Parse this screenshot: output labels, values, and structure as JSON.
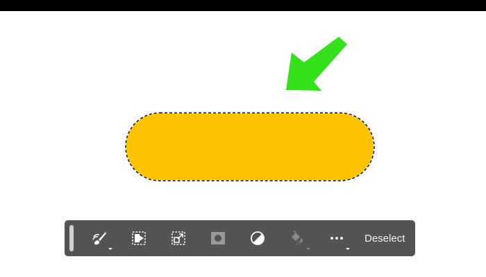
{
  "toolbar": {
    "tools": [
      {
        "icon": "brush-icon",
        "has_menu": true
      },
      {
        "icon": "select-subject-icon",
        "has_menu": false
      },
      {
        "icon": "transform-selection-icon",
        "has_menu": false
      },
      {
        "icon": "mask-icon",
        "has_menu": false
      },
      {
        "icon": "adjustment-layer-icon",
        "has_menu": false
      },
      {
        "icon": "fill-bucket-icon",
        "has_menu": true,
        "disabled": true
      },
      {
        "icon": "more-options-icon",
        "has_menu": true
      }
    ],
    "deselect_label": "Deselect"
  },
  "colors": {
    "shape_fill": "#FDC300",
    "arrow": "#33E01A",
    "toolbar_bg": "#535353",
    "top_bar": "#000000"
  }
}
